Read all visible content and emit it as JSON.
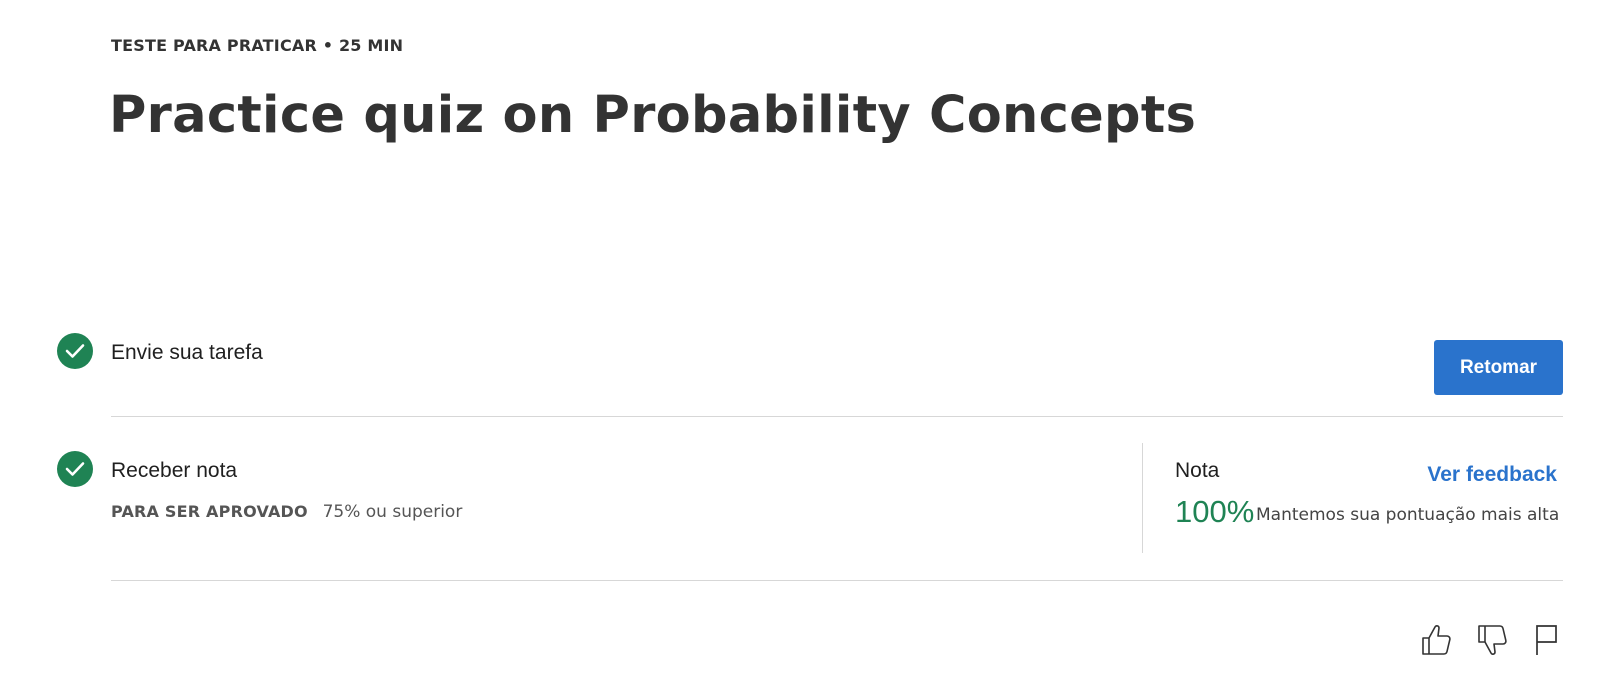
{
  "header": {
    "kicker": "TESTE PARA PRATICAR • 25 MIN",
    "title": "Practice quiz on Probability Concepts"
  },
  "steps": [
    {
      "label": "Envie sua tarefa",
      "status": "completed",
      "action_label": "Retomar"
    },
    {
      "label": "Receber nota",
      "status": "completed",
      "pass_label": "PARA SER APROVADO",
      "pass_value": "75% ou superior"
    }
  ],
  "grade": {
    "label": "Nota",
    "value": "100%",
    "note": "Mantemos sua pontuação mais alta",
    "feedback_link": "Ver feedback"
  },
  "feedback_icons": [
    "thumbs-up-icon",
    "thumbs-down-icon",
    "flag-icon"
  ],
  "colors": {
    "accent_blue": "#2a73cc",
    "success_green": "#1f8354",
    "text_dark": "#333333",
    "divider": "#d7d7d7"
  }
}
